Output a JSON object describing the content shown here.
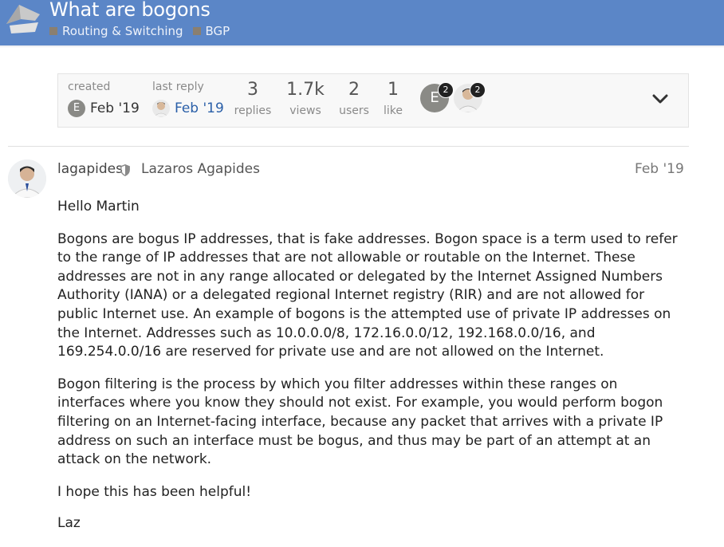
{
  "topic": {
    "title": "What are bogons",
    "breadcrumbs": [
      {
        "label": "Routing & Switching"
      },
      {
        "label": "BGP"
      }
    ]
  },
  "topic_map": {
    "created_label": "created",
    "created_date": "Feb '19",
    "created_avatar_letter": "E",
    "last_reply_label": "last reply",
    "last_reply_date": "Feb '19",
    "stats": [
      {
        "value": "3",
        "label": "replies"
      },
      {
        "value": "1.7k",
        "label": "views"
      },
      {
        "value": "2",
        "label": "users"
      },
      {
        "value": "1",
        "label": "like"
      }
    ],
    "participants": [
      {
        "letter": "E",
        "count": "2"
      },
      {
        "letter": "",
        "count": "2"
      }
    ]
  },
  "post": {
    "username": "lagapides",
    "full_name": "Lazaros Agapides",
    "date": "Feb '19",
    "paragraphs": [
      "Hello Martin",
      "Bogons are bogus IP addresses, that is fake addresses. Bogon space is a term used to refer to the range of IP addresses that are not allowable or routable on the Internet. These addresses are not in any range allocated or delegated by the Internet Assigned Numbers Authority (IANA) or a delegated regional Internet registry (RIR) and are not allowed for public Internet use. An example of bogons is the attempted use of private IP addresses on the Internet. Addresses such as 10.0.0.0/8, 172.16.0.0/12, 192.168.0.0/16, and 169.254.0.0/16 are reserved for private use and are not allowed on the Internet.",
      "Bogon filtering is the process by which you filter addresses within these ranges on interfaces where you know they should not exist. For example, you would perform bogon filtering on an Internet-facing interface, because any packet that arrives with a private IP address on such an interface must be bogus, and thus may be part of an attempt at an attack on the network.",
      "I hope this has been helpful!",
      "Laz"
    ]
  },
  "colors": {
    "header_bg": "#5b86c7",
    "link": "#2a5fa8",
    "category_swatch": "#8a7f70"
  },
  "icons": {
    "logo": "bird-logo-icon",
    "moderator": "shield-icon",
    "expand": "chevron-down-icon"
  }
}
